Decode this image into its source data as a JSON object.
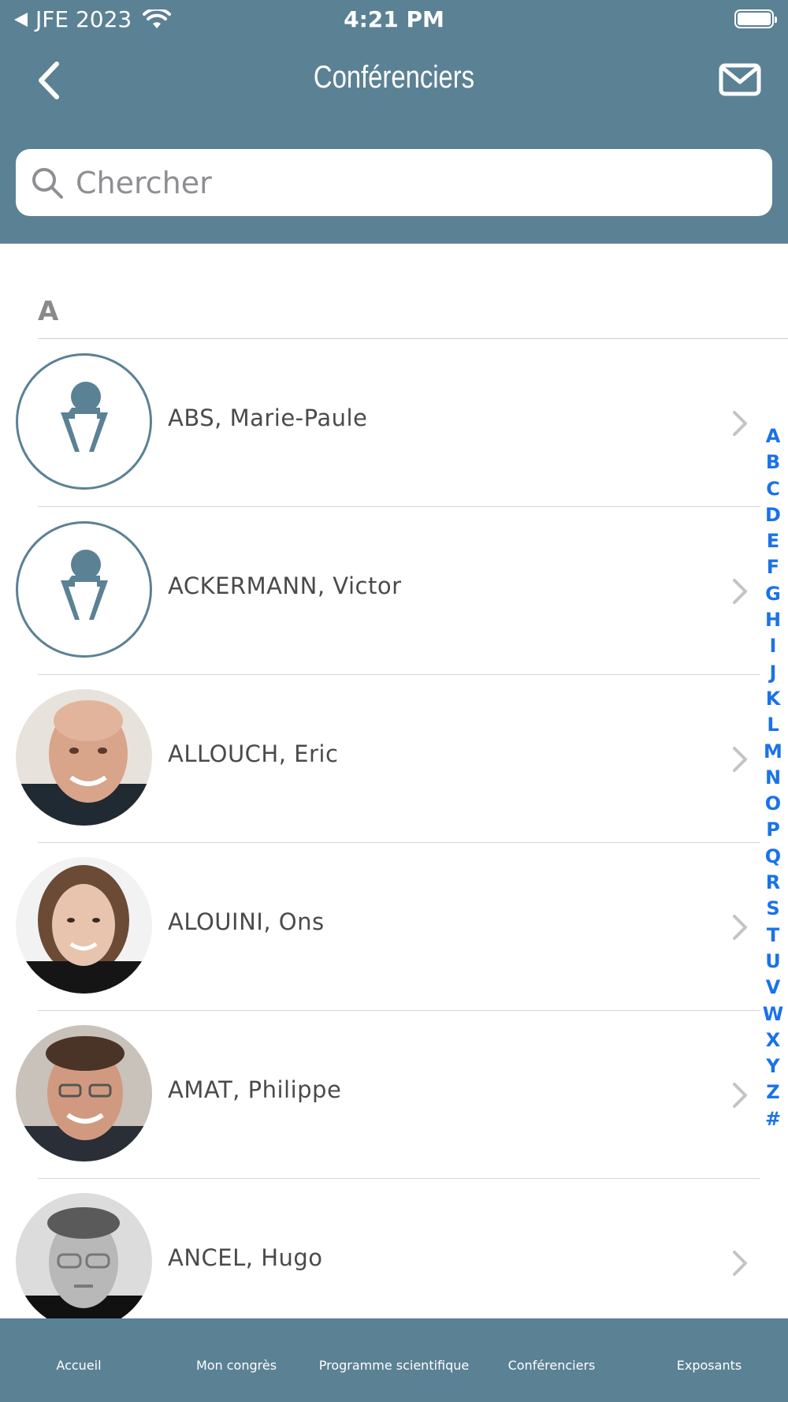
{
  "status_bar": {
    "carrier": "JFE 2023",
    "time": "4:21 PM"
  },
  "nav": {
    "title": "Conférenciers",
    "back_icon": "chevron-left-icon",
    "mail_icon": "envelope-icon"
  },
  "search": {
    "placeholder": "Chercher",
    "value": ""
  },
  "section": {
    "header": "A"
  },
  "speakers": [
    {
      "name": "ABS, Marie-Paule",
      "photo": "placeholder"
    },
    {
      "name": "ACKERMANN, Victor",
      "photo": "placeholder"
    },
    {
      "name": "ALLOUCH, Eric",
      "photo": "photo"
    },
    {
      "name": "ALOUINI, Ons",
      "photo": "photo"
    },
    {
      "name": "AMAT, Philippe",
      "photo": "photo"
    },
    {
      "name": "ANCEL, Hugo",
      "photo": "photo"
    }
  ],
  "index_letters": [
    "A",
    "B",
    "C",
    "D",
    "E",
    "F",
    "G",
    "H",
    "I",
    "J",
    "K",
    "L",
    "M",
    "N",
    "O",
    "P",
    "Q",
    "R",
    "S",
    "T",
    "U",
    "V",
    "W",
    "X",
    "Y",
    "Z",
    "#"
  ],
  "tabs": [
    "Accueil",
    "Mon congrès",
    "Programme scientifique",
    "Conférenciers",
    "Exposants"
  ],
  "colors": {
    "header": "#5b8194",
    "index_letter": "#1a73e8"
  }
}
